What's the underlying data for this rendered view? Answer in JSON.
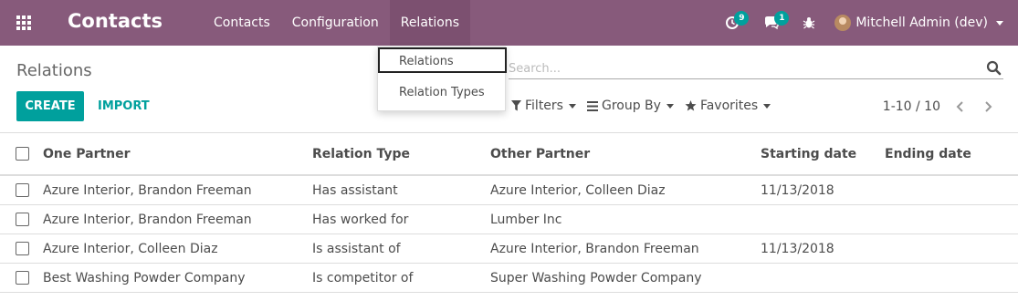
{
  "navbar": {
    "brand": "Contacts",
    "menu": [
      "Contacts",
      "Configuration",
      "Relations"
    ],
    "activities_count": "9",
    "messages_count": "1",
    "user_name": "Mitchell Admin (dev)",
    "color": "#875a7b"
  },
  "dropdown": {
    "items": [
      "Relations",
      "Relation Types"
    ]
  },
  "control_panel": {
    "title": "Relations",
    "create_label": "CREATE",
    "import_label": "IMPORT",
    "search_placeholder": "Search...",
    "filters_label": "Filters",
    "group_by_label": "Group By",
    "favorites_label": "Favorites",
    "pager": "1-10 / 10",
    "accent": "#00a09d"
  },
  "table": {
    "columns": [
      "One Partner",
      "Relation Type",
      "Other Partner",
      "Starting date",
      "Ending date"
    ],
    "rows": [
      [
        "Azure Interior, Brandon Freeman",
        "Has assistant",
        "Azure Interior, Colleen Diaz",
        "11/13/2018",
        ""
      ],
      [
        "Azure Interior, Brandon Freeman",
        "Has worked for",
        "Lumber Inc",
        "",
        ""
      ],
      [
        "Azure Interior, Colleen Diaz",
        "Is assistant of",
        "Azure Interior, Brandon Freeman",
        "11/13/2018",
        ""
      ],
      [
        "Best Washing Powder Company",
        "Is competitor of",
        "Super Washing Powder Company",
        "",
        ""
      ]
    ]
  }
}
